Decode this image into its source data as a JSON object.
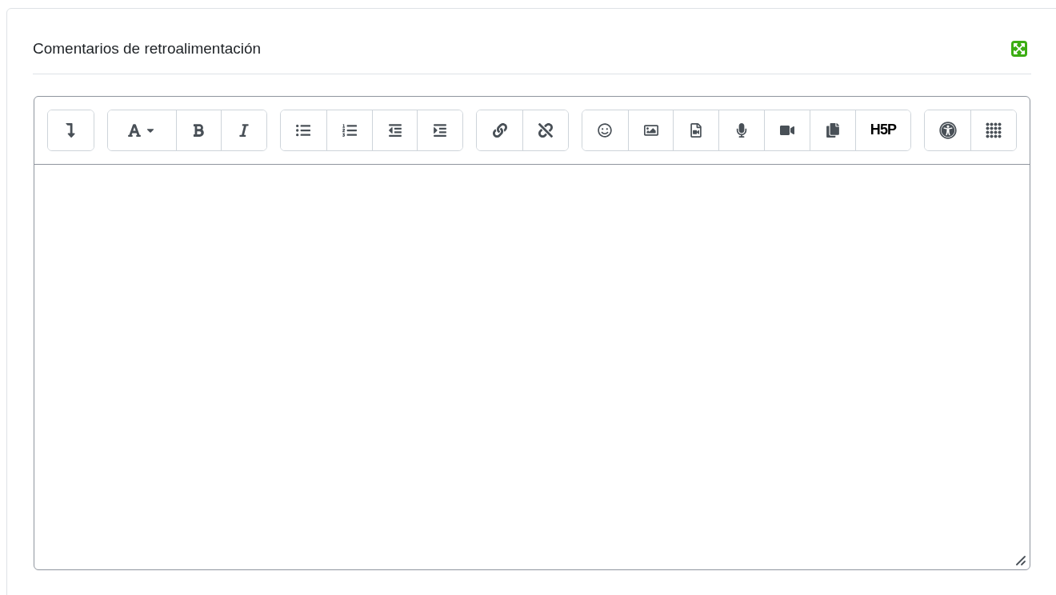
{
  "section": {
    "title": "Comentarios de retroalimentación"
  },
  "toolbar": {
    "groups": [
      {
        "buttons": [
          {
            "kind": "collapse"
          }
        ]
      },
      {
        "buttons": [
          {
            "kind": "font"
          },
          {
            "kind": "bold"
          },
          {
            "kind": "italic"
          }
        ]
      },
      {
        "buttons": [
          {
            "kind": "bullets"
          },
          {
            "kind": "numbers"
          },
          {
            "kind": "outdent"
          },
          {
            "kind": "indent"
          }
        ]
      },
      {
        "buttons": [
          {
            "kind": "link"
          },
          {
            "kind": "unlink"
          }
        ]
      },
      {
        "buttons": [
          {
            "kind": "emoji"
          },
          {
            "kind": "image"
          },
          {
            "kind": "media"
          },
          {
            "kind": "audio"
          },
          {
            "kind": "video"
          },
          {
            "kind": "copy"
          },
          {
            "kind": "text",
            "label": "H5P"
          }
        ]
      },
      {
        "buttons": [
          {
            "kind": "accessibility"
          },
          {
            "kind": "grid"
          }
        ]
      }
    ]
  }
}
